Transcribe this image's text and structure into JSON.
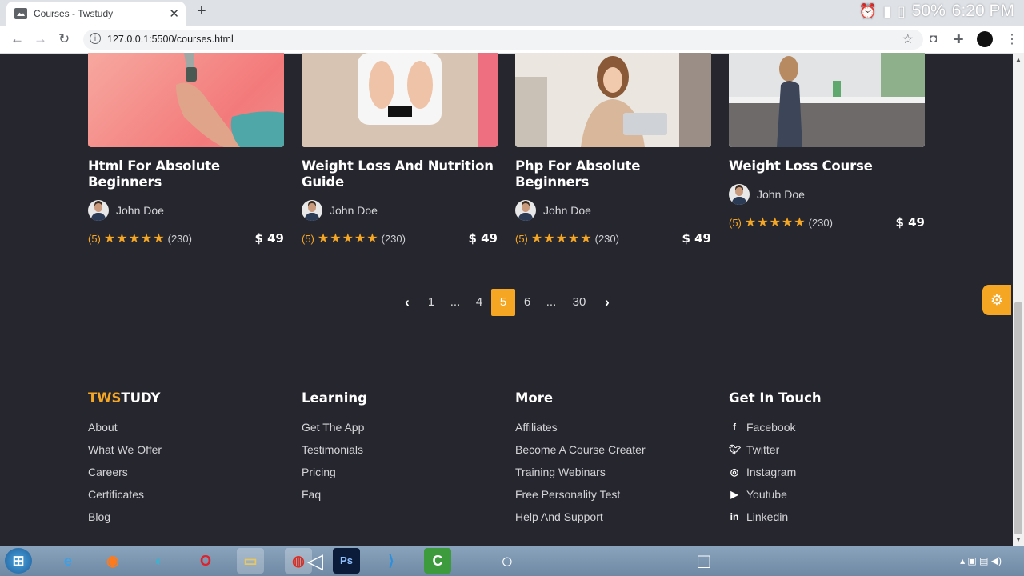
{
  "browser": {
    "tab_title": "Courses - Twstudy",
    "url": "127.0.0.1:5500/courses.html",
    "status_battery": "50%",
    "status_time": "6:20 PM"
  },
  "courses": [
    {
      "title": "Html For Absolute Beginners",
      "author": "John Doe",
      "rating": "(5)",
      "reviews": "(230)",
      "price": "$ 49"
    },
    {
      "title": "Weight Loss And Nutrition Guide",
      "author": "John Doe",
      "rating": "(5)",
      "reviews": "(230)",
      "price": "$ 49"
    },
    {
      "title": "Php For Absolute Beginners",
      "author": "John Doe",
      "rating": "(5)",
      "reviews": "(230)",
      "price": "$ 49"
    },
    {
      "title": "Weight Loss Course",
      "author": "John Doe",
      "rating": "(5)",
      "reviews": "(230)",
      "price": "$ 49"
    }
  ],
  "pagination": {
    "pages": [
      "1",
      "...",
      "4",
      "5",
      "6",
      "...",
      "30"
    ],
    "current": "5"
  },
  "footer": {
    "brand_accent": "TWS",
    "brand_rest": "TUDY",
    "brand_links": [
      "About",
      "What We Offer",
      "Careers",
      "Certificates",
      "Blog"
    ],
    "learning_title": "Learning",
    "learning_links": [
      "Get The App",
      "Testimonials",
      "Pricing",
      "Faq"
    ],
    "more_title": "More",
    "more_links": [
      "Affiliates",
      "Become A Course Creater",
      "Training Webinars",
      "Free Personality Test",
      "Help And Support"
    ],
    "contact_title": "Get In Touch",
    "contact_links": [
      {
        "label": "Facebook",
        "icon": "facebook-icon"
      },
      {
        "label": "Twitter",
        "icon": "twitter-icon"
      },
      {
        "label": "Instagram",
        "icon": "instagram-icon"
      },
      {
        "label": "Youtube",
        "icon": "youtube-icon"
      },
      {
        "label": "Linkedin",
        "icon": "linkedin-icon"
      }
    ]
  },
  "colors": {
    "accent": "#f5a623",
    "background": "#26262f"
  }
}
